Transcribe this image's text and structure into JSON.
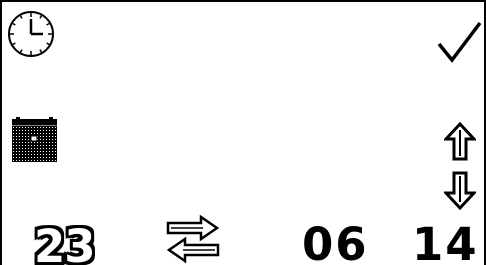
{
  "screen": {
    "icons": {
      "clock": "clock-icon",
      "confirm": "checkmark-icon",
      "calendar": "calendar-icon",
      "increase": "arrow-up-icon",
      "decrease": "arrow-down-icon",
      "toggle": "swap-arrows-icon"
    },
    "time": {
      "day": "23",
      "hour": "06",
      "minute": "14"
    },
    "colors": {
      "foreground": "#000000",
      "background": "#ffffff"
    }
  }
}
